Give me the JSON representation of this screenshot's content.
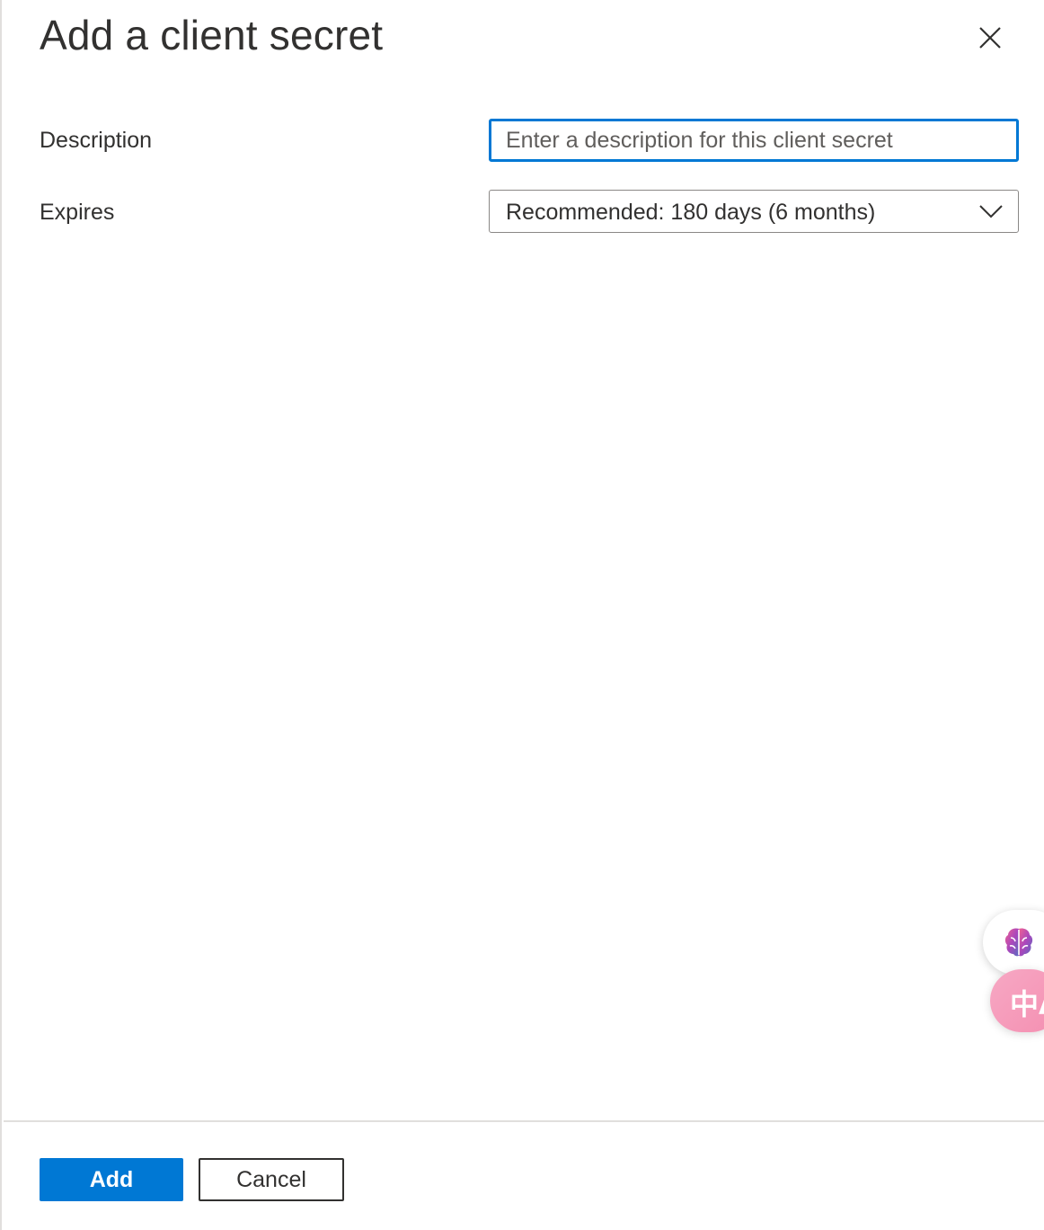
{
  "panel": {
    "title": "Add a client secret"
  },
  "form": {
    "description": {
      "label": "Description",
      "value": "",
      "placeholder": "Enter a description for this client secret"
    },
    "expires": {
      "label": "Expires",
      "selected": "Recommended: 180 days (6 months)"
    }
  },
  "footer": {
    "add_label": "Add",
    "cancel_label": "Cancel"
  },
  "floating": {
    "brain_icon": "brain-icon",
    "translate_icon": "translate-icon",
    "translate_glyph": "中A"
  },
  "colors": {
    "accent": "#0078d4",
    "text": "#323130",
    "border": "#8a8886"
  }
}
